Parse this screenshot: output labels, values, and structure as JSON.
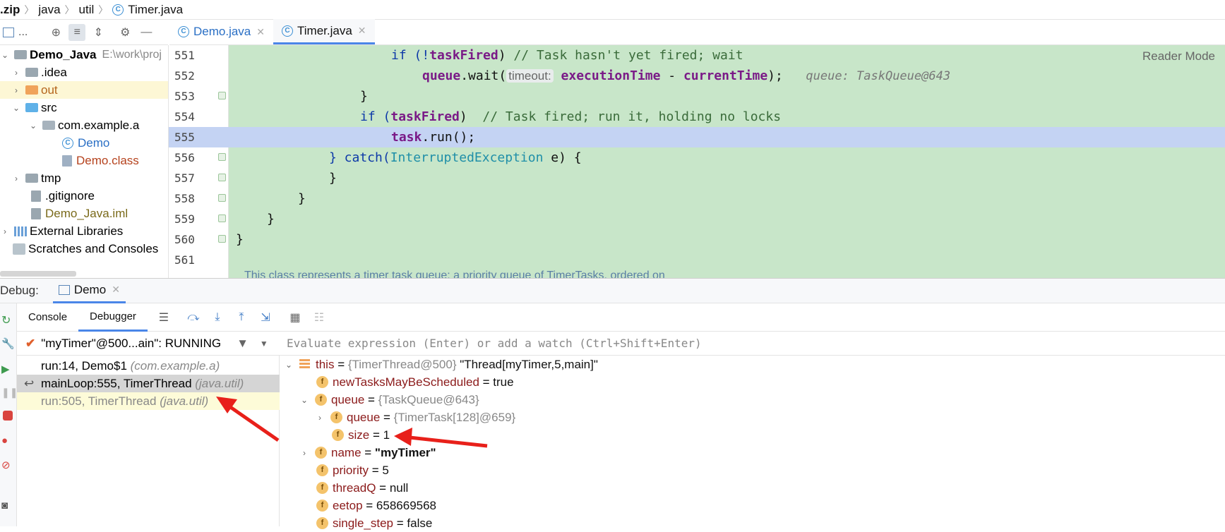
{
  "breadcrumb": {
    "items": [
      ".zip",
      "java",
      "util",
      "Timer.java"
    ]
  },
  "project_toolbar": {
    "label": "..."
  },
  "editor_tabs": [
    {
      "label": "Demo.java"
    },
    {
      "label": "Timer.java"
    }
  ],
  "project_tree": {
    "root": {
      "name": "Demo_Java",
      "path": "E:\\work\\proj"
    },
    "items": [
      ".idea",
      "out",
      "src",
      "com.example.a",
      "Demo",
      "Demo.class",
      "tmp",
      ".gitignore",
      "Demo_Java.iml",
      "External Libraries",
      "Scratches and Consoles"
    ]
  },
  "editor": {
    "reader_mode": "Reader Mode",
    "line_numbers": [
      "551",
      "552",
      "553",
      "554",
      "555",
      "556",
      "557",
      "558",
      "559",
      "560",
      "561"
    ],
    "current_line": "555",
    "lines": [
      {
        "t1": "if (!",
        "f1": "taskFired",
        "t2": ") ",
        "c": "// Task hasn't yet fired; wait"
      },
      {
        "f1": "queue",
        "t1": ".wait(",
        "hint": "timeout:",
        "f2": "executionTime",
        "t2": " - ",
        "f3": "currentTime",
        "t3": ");",
        "inline": "queue: TaskQueue@643"
      },
      {
        "t1": "}"
      },
      {
        "t1": "if (",
        "f1": "taskFired",
        "t2": ")  ",
        "c": "// Task fired; run it, holding no locks"
      },
      {
        "f1": "task",
        "t1": ".run();"
      },
      {
        "t1": "} catch(",
        "ty": "InterruptedException",
        "t2": " e) {"
      },
      {
        "t1": "}"
      },
      {
        "t1": "}"
      },
      {
        "t1": "}"
      },
      {
        "t1": "}"
      },
      {
        "t1": ""
      }
    ],
    "doc_comment": "This class represents a timer task queue: a priority queue of TimerTasks, ordered on"
  },
  "debug": {
    "label": "Debug:",
    "session_tab": "Demo",
    "subtabs": [
      "Console",
      "Debugger"
    ],
    "thread": "\"myTimer\"@500...ain\": RUNNING",
    "eval_placeholder": "Evaluate expression (Enter) or add a watch (Ctrl+Shift+Enter)",
    "frames": [
      {
        "method": "run:14, Demo$1",
        "pkg": "(com.example.a)"
      },
      {
        "method": "mainLoop:555, TimerThread",
        "pkg": "(java.util)"
      },
      {
        "method": "run:505, TimerThread",
        "pkg": "(java.util)"
      }
    ],
    "variables": [
      {
        "name": "this",
        "ref": "{TimerThread@500}",
        "value": "\"Thread[myTimer,5,main]\""
      },
      {
        "name": "newTasksMayBeScheduled",
        "value": "true"
      },
      {
        "name": "queue",
        "ref": "{TaskQueue@643}"
      },
      {
        "name": "queue",
        "ref": "{TimerTask[128]@659}"
      },
      {
        "name": "size",
        "value": "1"
      },
      {
        "name": "name",
        "value": "\"myTimer\""
      },
      {
        "name": "priority",
        "value": "5"
      },
      {
        "name": "threadQ",
        "value": "null"
      },
      {
        "name": "eetop",
        "value": "658669568"
      },
      {
        "name": "single_step",
        "value": "false"
      }
    ]
  },
  "colors": {
    "editor_bg": "#c8e6c9",
    "current_line": "#c4d3f3",
    "annotation_arrow": "#e8201a"
  }
}
